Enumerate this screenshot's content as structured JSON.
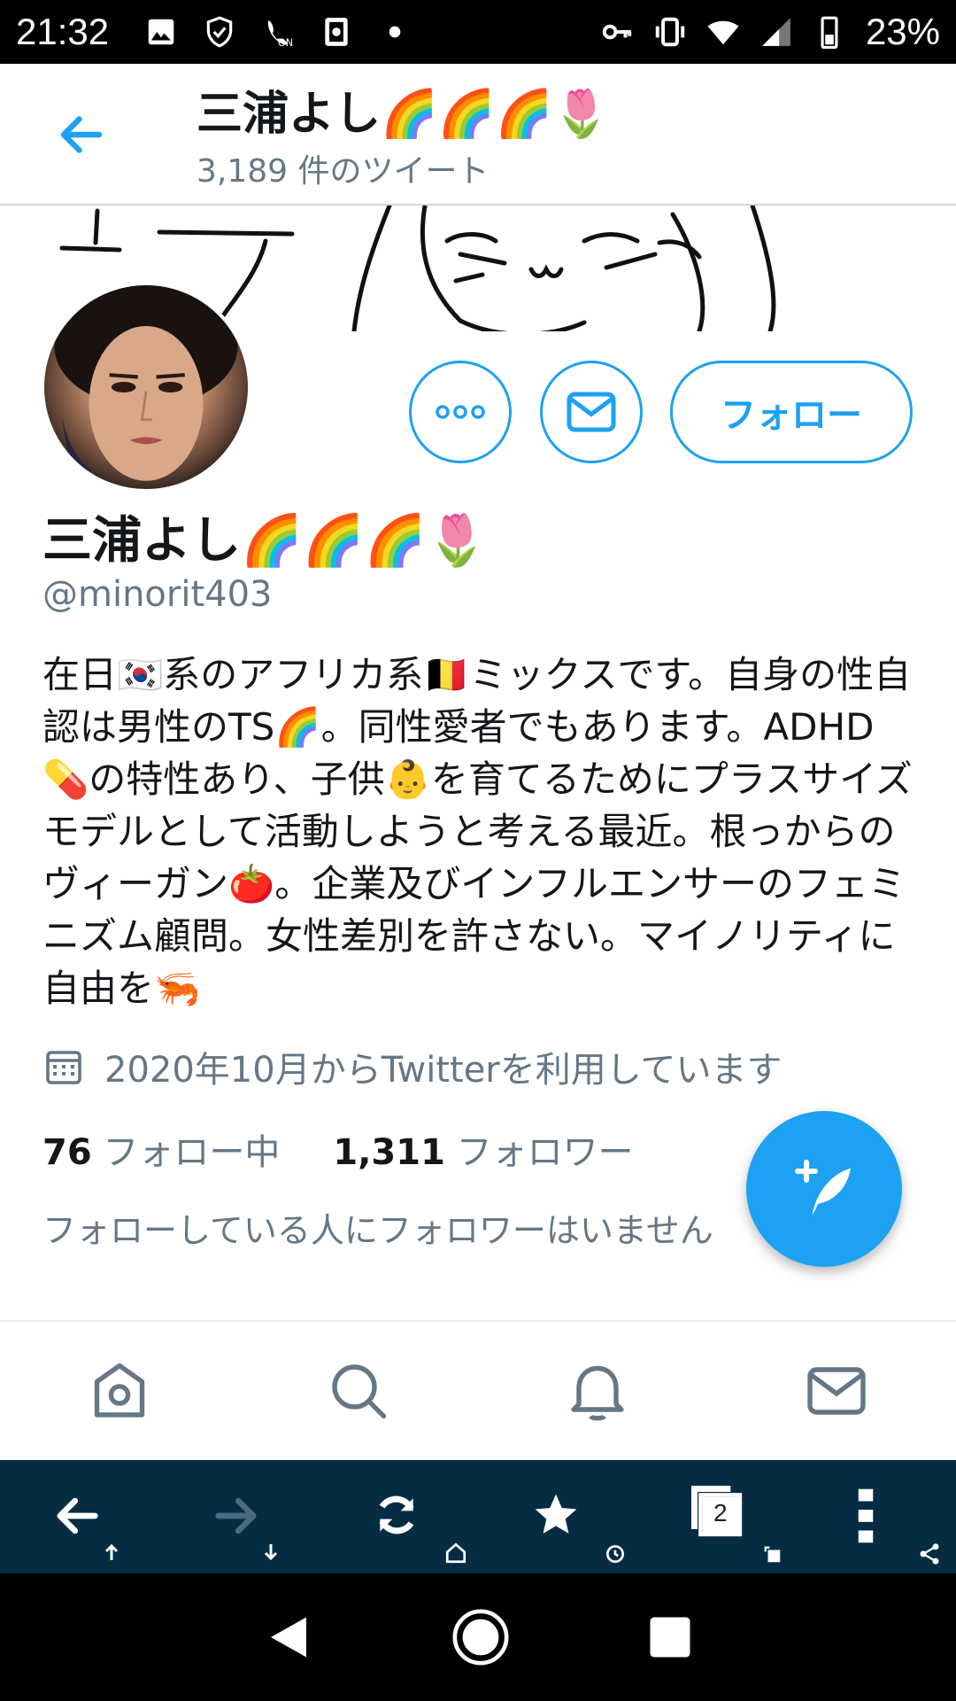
{
  "status_bar": {
    "time": "21:32",
    "battery_percent": "23%",
    "left_icons": [
      "image-icon",
      "shield-check-icon",
      "call-on-icon",
      "card-icon",
      "dot-icon"
    ],
    "right_icons": [
      "key-icon",
      "vibrate-icon",
      "wifi-icon",
      "signal-icon",
      "battery-icon"
    ]
  },
  "header": {
    "name": "三浦よし🌈🌈🌈🌷",
    "tweet_count": "3,189 件のツイート"
  },
  "profile": {
    "name": "三浦よし🌈🌈🌈🌷",
    "handle": "@minorit403",
    "bio": "在日🇰🇷系のアフリカ系🇧🇪ミックスです。自身の性自認は男性のTS🌈。同性愛者でもあります。ADHD💊の特性あり、子供👶を育てるためにプラスサイズモデルとして活動しようと考える最近。根っからのヴィーガン🍅。企業及びインフルエンサーのフェミニズム顧問。女性差別を許さない。マイノリティに自由を🦐",
    "joined": "2020年10月からTwitterを利用しています",
    "following_count": "76",
    "following_label": "フォロー中",
    "followers_count": "1,311",
    "followers_label": "フォロワー",
    "no_mutual_text": "フォローしている人にフォロワーはいません",
    "follow_button": "フォロー"
  },
  "browser_toolbar": {
    "tabs_count": "2"
  },
  "colors": {
    "accent": "#1da1f2",
    "secondary_text": "#657786",
    "browser_bar": "#062c44"
  }
}
